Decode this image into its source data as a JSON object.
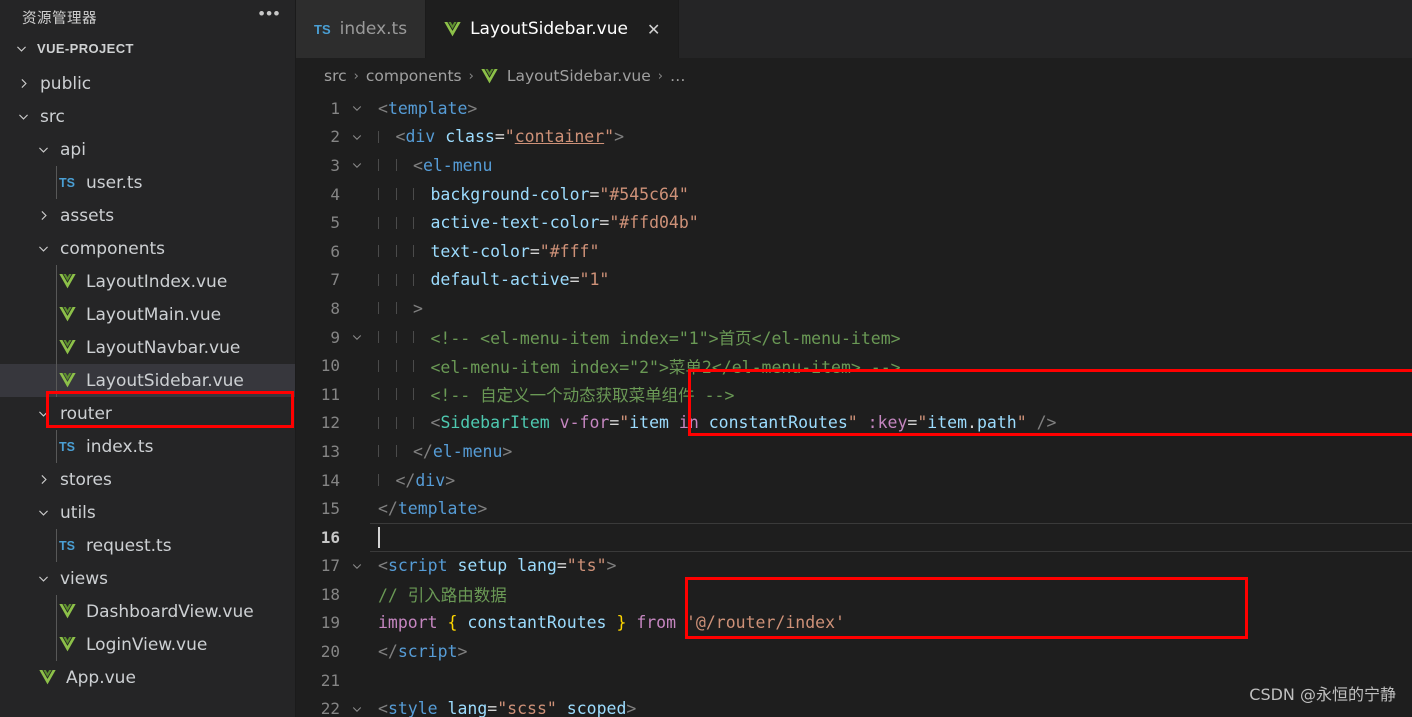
{
  "sidebar": {
    "title": "资源管理器",
    "more_label": "•••",
    "root": {
      "label": "VUE-PROJECT",
      "expanded": true
    },
    "items": [
      {
        "label": "public",
        "kind": "folder",
        "expanded": false,
        "depth": 1,
        "selected": false
      },
      {
        "label": "src",
        "kind": "folder",
        "expanded": true,
        "depth": 1,
        "selected": false
      },
      {
        "label": "api",
        "kind": "folder",
        "expanded": true,
        "depth": 2,
        "selected": false
      },
      {
        "label": "user.ts",
        "kind": "ts",
        "depth": 3,
        "selected": false
      },
      {
        "label": "assets",
        "kind": "folder",
        "expanded": false,
        "depth": 2,
        "selected": false
      },
      {
        "label": "components",
        "kind": "folder",
        "expanded": true,
        "depth": 2,
        "selected": false
      },
      {
        "label": "LayoutIndex.vue",
        "kind": "vue",
        "depth": 3,
        "selected": false
      },
      {
        "label": "LayoutMain.vue",
        "kind": "vue",
        "depth": 3,
        "selected": false
      },
      {
        "label": "LayoutNavbar.vue",
        "kind": "vue",
        "depth": 3,
        "selected": false
      },
      {
        "label": "LayoutSidebar.vue",
        "kind": "vue",
        "depth": 3,
        "selected": true
      },
      {
        "label": "router",
        "kind": "folder",
        "expanded": true,
        "depth": 2,
        "selected": false
      },
      {
        "label": "index.ts",
        "kind": "ts",
        "depth": 3,
        "selected": false
      },
      {
        "label": "stores",
        "kind": "folder",
        "expanded": false,
        "depth": 2,
        "selected": false
      },
      {
        "label": "utils",
        "kind": "folder",
        "expanded": true,
        "depth": 2,
        "selected": false
      },
      {
        "label": "request.ts",
        "kind": "ts",
        "depth": 3,
        "selected": false
      },
      {
        "label": "views",
        "kind": "folder",
        "expanded": true,
        "depth": 2,
        "selected": false
      },
      {
        "label": "DashboardView.vue",
        "kind": "vue",
        "depth": 3,
        "selected": false
      },
      {
        "label": "LoginView.vue",
        "kind": "vue",
        "depth": 3,
        "selected": false
      },
      {
        "label": "App.vue",
        "kind": "vue",
        "depth": 2,
        "selected": false
      }
    ]
  },
  "tabs": [
    {
      "label": "index.ts",
      "icon": "ts",
      "active": false,
      "closable": false
    },
    {
      "label": "LayoutSidebar.vue",
      "icon": "vue",
      "active": true,
      "closable": true,
      "close_label": "✕"
    }
  ],
  "breadcrumb": {
    "items": [
      "src",
      "components",
      "LayoutSidebar.vue",
      "…"
    ],
    "separator": "›"
  },
  "editor": {
    "active_line": 16,
    "lines": [
      {
        "n": 1,
        "fold": "down",
        "indent": 0,
        "tokens": [
          {
            "t": "t-brack",
            "v": "<"
          },
          {
            "t": "t-tag",
            "v": "template"
          },
          {
            "t": "t-brack",
            "v": ">"
          }
        ]
      },
      {
        "n": 2,
        "fold": "down",
        "indent": 1,
        "tokens": [
          {
            "t": "t-brack",
            "v": "<"
          },
          {
            "t": "t-tag",
            "v": "div"
          },
          {
            "t": "t-plain",
            "v": " "
          },
          {
            "t": "t-attr",
            "v": "class"
          },
          {
            "t": "t-plain",
            "v": "="
          },
          {
            "t": "t-str",
            "v": "\""
          },
          {
            "t": "t-link",
            "v": "container"
          },
          {
            "t": "t-str",
            "v": "\""
          },
          {
            "t": "t-brack",
            "v": ">"
          }
        ]
      },
      {
        "n": 3,
        "fold": "down",
        "indent": 2,
        "tokens": [
          {
            "t": "t-brack",
            "v": "<"
          },
          {
            "t": "t-tag",
            "v": "el-menu"
          }
        ]
      },
      {
        "n": 4,
        "fold": "",
        "indent": 3,
        "tokens": [
          {
            "t": "t-attr",
            "v": "background-color"
          },
          {
            "t": "t-plain",
            "v": "="
          },
          {
            "t": "t-str",
            "v": "\"#545c64\""
          }
        ]
      },
      {
        "n": 5,
        "fold": "",
        "indent": 3,
        "tokens": [
          {
            "t": "t-attr",
            "v": "active-text-color"
          },
          {
            "t": "t-plain",
            "v": "="
          },
          {
            "t": "t-str",
            "v": "\"#ffd04b\""
          }
        ]
      },
      {
        "n": 6,
        "fold": "",
        "indent": 3,
        "tokens": [
          {
            "t": "t-attr",
            "v": "text-color"
          },
          {
            "t": "t-plain",
            "v": "="
          },
          {
            "t": "t-str",
            "v": "\"#fff\""
          }
        ]
      },
      {
        "n": 7,
        "fold": "",
        "indent": 3,
        "tokens": [
          {
            "t": "t-attr",
            "v": "default-active"
          },
          {
            "t": "t-plain",
            "v": "="
          },
          {
            "t": "t-str",
            "v": "\"1\""
          }
        ]
      },
      {
        "n": 8,
        "fold": "",
        "indent": 2,
        "tokens": [
          {
            "t": "t-brack",
            "v": ">"
          }
        ]
      },
      {
        "n": 9,
        "fold": "down",
        "indent": 3,
        "tokens": [
          {
            "t": "t-comment",
            "v": "<!-- <el-menu-item index=\"1\">首页</el-menu-item>"
          }
        ]
      },
      {
        "n": 10,
        "fold": "",
        "indent": 3,
        "tokens": [
          {
            "t": "t-comment",
            "v": "<el-menu-item index=\"2\">菜单2</el-menu-item> -->"
          }
        ]
      },
      {
        "n": 11,
        "fold": "",
        "indent": 3,
        "tokens": [
          {
            "t": "t-comment",
            "v": "<!-- 自定义一个动态获取菜单组件 -->"
          }
        ]
      },
      {
        "n": 12,
        "fold": "",
        "indent": 3,
        "tokens": [
          {
            "t": "t-brack",
            "v": "<"
          },
          {
            "t": "t-comp",
            "v": "SidebarItem"
          },
          {
            "t": "t-plain",
            "v": " "
          },
          {
            "t": "t-kw",
            "v": "v-for"
          },
          {
            "t": "t-plain",
            "v": "="
          },
          {
            "t": "t-str",
            "v": "\""
          },
          {
            "t": "t-var",
            "v": "item"
          },
          {
            "t": "t-plain",
            "v": " "
          },
          {
            "t": "t-kw",
            "v": "in"
          },
          {
            "t": "t-plain",
            "v": " "
          },
          {
            "t": "t-var",
            "v": "constantRoutes"
          },
          {
            "t": "t-str",
            "v": "\""
          },
          {
            "t": "t-plain",
            "v": " "
          },
          {
            "t": "t-kw",
            "v": ":key"
          },
          {
            "t": "t-plain",
            "v": "="
          },
          {
            "t": "t-str",
            "v": "\""
          },
          {
            "t": "t-var",
            "v": "item"
          },
          {
            "t": "t-plain",
            "v": "."
          },
          {
            "t": "t-var",
            "v": "path"
          },
          {
            "t": "t-str",
            "v": "\""
          },
          {
            "t": "t-plain",
            "v": " "
          },
          {
            "t": "t-brack",
            "v": "/>"
          }
        ]
      },
      {
        "n": 13,
        "fold": "",
        "indent": 2,
        "tokens": [
          {
            "t": "t-brack",
            "v": "</"
          },
          {
            "t": "t-tag",
            "v": "el-menu"
          },
          {
            "t": "t-brack",
            "v": ">"
          }
        ]
      },
      {
        "n": 14,
        "fold": "",
        "indent": 1,
        "tokens": [
          {
            "t": "t-brack",
            "v": "</"
          },
          {
            "t": "t-tag",
            "v": "div"
          },
          {
            "t": "t-brack",
            "v": ">"
          }
        ]
      },
      {
        "n": 15,
        "fold": "",
        "indent": 0,
        "tokens": [
          {
            "t": "t-brack",
            "v": "</"
          },
          {
            "t": "t-tag",
            "v": "template"
          },
          {
            "t": "t-brack",
            "v": ">"
          }
        ]
      },
      {
        "n": 16,
        "fold": "",
        "indent": 0,
        "cursor": true,
        "tokens": []
      },
      {
        "n": 17,
        "fold": "down",
        "indent": 0,
        "tokens": [
          {
            "t": "t-brack",
            "v": "<"
          },
          {
            "t": "t-tag",
            "v": "script"
          },
          {
            "t": "t-plain",
            "v": " "
          },
          {
            "t": "t-attr",
            "v": "setup"
          },
          {
            "t": "t-plain",
            "v": " "
          },
          {
            "t": "t-attr",
            "v": "lang"
          },
          {
            "t": "t-plain",
            "v": "="
          },
          {
            "t": "t-str",
            "v": "\"ts\""
          },
          {
            "t": "t-brack",
            "v": ">"
          }
        ]
      },
      {
        "n": 18,
        "fold": "",
        "indent": 0,
        "tokens": [
          {
            "t": "t-comment",
            "v": "// 引入路由数据"
          }
        ]
      },
      {
        "n": 19,
        "fold": "",
        "indent": 0,
        "tokens": [
          {
            "t": "t-kw",
            "v": "import"
          },
          {
            "t": "t-plain",
            "v": " "
          },
          {
            "t": "t-curly",
            "v": "{"
          },
          {
            "t": "t-plain",
            "v": " "
          },
          {
            "t": "t-var",
            "v": "constantRoutes"
          },
          {
            "t": "t-plain",
            "v": " "
          },
          {
            "t": "t-curly",
            "v": "}"
          },
          {
            "t": "t-plain",
            "v": " "
          },
          {
            "t": "t-kw",
            "v": "from"
          },
          {
            "t": "t-plain",
            "v": " "
          },
          {
            "t": "t-str",
            "v": "'@/router/index'"
          }
        ]
      },
      {
        "n": 20,
        "fold": "",
        "indent": 0,
        "tokens": [
          {
            "t": "t-brack",
            "v": "</"
          },
          {
            "t": "t-tag",
            "v": "script"
          },
          {
            "t": "t-brack",
            "v": ">"
          }
        ]
      },
      {
        "n": 21,
        "fold": "",
        "indent": 0,
        "tokens": []
      },
      {
        "n": 22,
        "fold": "down",
        "indent": 0,
        "tokens": [
          {
            "t": "t-brack",
            "v": "<"
          },
          {
            "t": "t-tag",
            "v": "style"
          },
          {
            "t": "t-plain",
            "v": " "
          },
          {
            "t": "t-attr",
            "v": "lang"
          },
          {
            "t": "t-plain",
            "v": "="
          },
          {
            "t": "t-str",
            "v": "\"scss\""
          },
          {
            "t": "t-plain",
            "v": " "
          },
          {
            "t": "t-attr",
            "v": "scoped"
          },
          {
            "t": "t-brack",
            "v": ">"
          }
        ]
      }
    ]
  },
  "annotations": [
    {
      "name": "sidebar-file-highlight",
      "color": "#ff0000"
    },
    {
      "name": "sidebar-item-component-highlight",
      "color": "#ff0000"
    },
    {
      "name": "import-statement-highlight",
      "color": "#ff0000"
    }
  ],
  "watermark": "CSDN @永恒的宁静"
}
